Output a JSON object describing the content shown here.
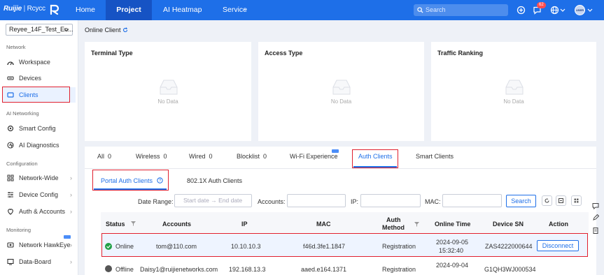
{
  "brand": {
    "logo_text": "Ruijie",
    "separator": "|",
    "sub_brand": "Rcycc"
  },
  "topnav": {
    "items": [
      "Home",
      "Project",
      "AI Heatmap",
      "Service"
    ],
    "active": "Project",
    "service_caret": "⌄"
  },
  "search": {
    "placeholder": "Search"
  },
  "notifications": {
    "count": "62"
  },
  "user": {
    "avatar_text": "USER"
  },
  "sidebar": {
    "site": "Reyee_14F_Test_En...",
    "sections": {
      "network": "Network",
      "ai": "AI Networking",
      "config": "Configuration",
      "monitoring": "Monitoring"
    },
    "items": {
      "workspace": "Workspace",
      "devices": "Devices",
      "clients": "Clients",
      "smart_config": "Smart Config",
      "ai_diagnostics": "AI Diagnostics",
      "network_wide": "Network-Wide",
      "device_config": "Device Config",
      "auth_accounts": "Auth & Accounts",
      "network_hawkeye": "Network HawkEye",
      "data_board": "Data-Board"
    }
  },
  "page": {
    "title": "Online Client"
  },
  "cards": [
    {
      "title": "Terminal Type",
      "empty": "No Data"
    },
    {
      "title": "Access Type",
      "empty": "No Data"
    },
    {
      "title": "Traffic Ranking",
      "empty": "No Data"
    }
  ],
  "tabs": {
    "all": "All",
    "all_count": "0",
    "wireless": "Wireless",
    "wireless_count": "0",
    "wired": "Wired",
    "wired_count": "0",
    "blocklist": "Blocklist",
    "blocklist_count": "0",
    "wifi_experience": "Wi-Fi Experience",
    "auth_clients": "Auth Clients",
    "smart_clients": "Smart Clients"
  },
  "subtabs": {
    "portal": "Portal Auth Clients",
    "dot1x": "802.1X Auth Clients"
  },
  "filters": {
    "date_label": "Date Range:",
    "start_placeholder": "Start date",
    "arrow": "→",
    "end_placeholder": "End date",
    "accounts_label": "Accounts:",
    "ip_label": "IP:",
    "mac_label": "MAC:",
    "search_button": "Search"
  },
  "table": {
    "headers": {
      "status": "Status",
      "accounts": "Accounts",
      "ip": "IP",
      "mac": "MAC",
      "auth_method_1": "Auth",
      "auth_method_2": "Method",
      "online_time": "Online Time",
      "device_sn": "Device SN",
      "action": "Action"
    },
    "rows": [
      {
        "status": "Online",
        "status_color": "#22a046",
        "account": "tom@110.com",
        "ip": "10.10.10.3",
        "mac": "f46d.3fe1.1847",
        "auth_method": "Registration",
        "date": "2024-09-05",
        "time": "15:32:40",
        "device_sn": "ZAS4222000644",
        "action": "Disconnect"
      },
      {
        "status": "Offline",
        "status_color": "#555555",
        "account": "Daisy1@ruijienetworks.com",
        "ip": "192.168.13.3",
        "mac": "aaed.e164.1371",
        "auth_method": "Registration",
        "date": "2024-09-04",
        "time": "",
        "device_sn": "G1QH3WJ000534",
        "action": ""
      }
    ]
  },
  "colors": {
    "primary": "#1e6fe8",
    "highlight": "#e0202f",
    "online": "#22a046"
  }
}
